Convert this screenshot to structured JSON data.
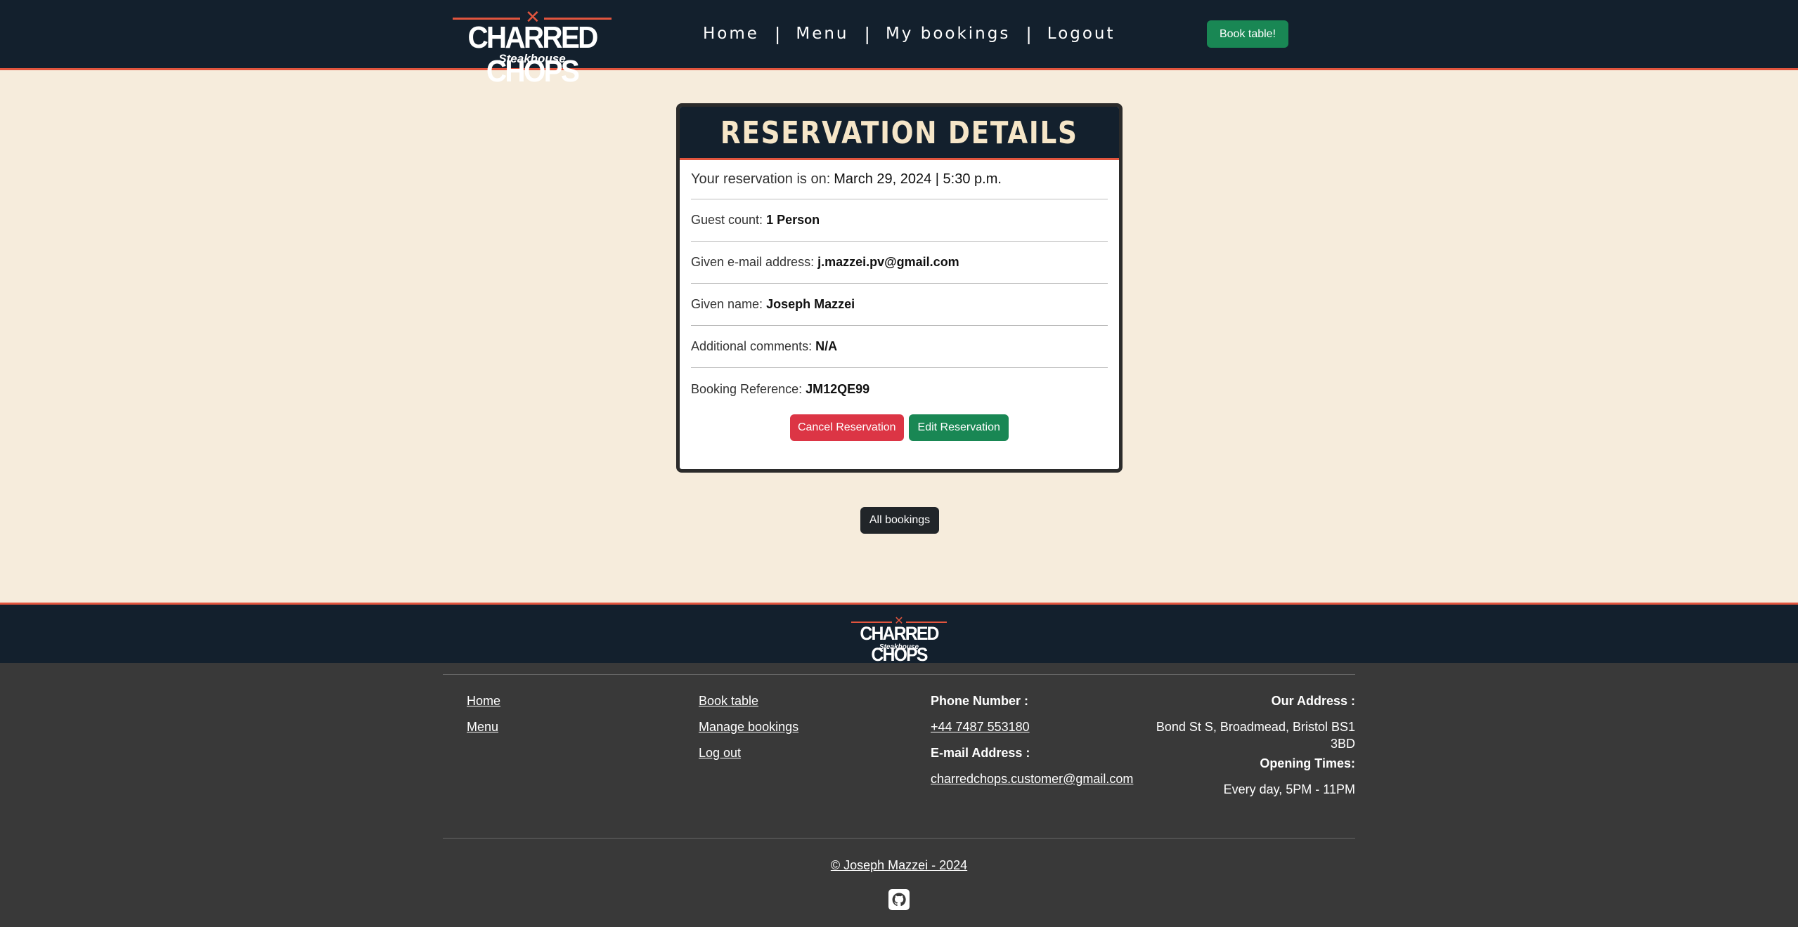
{
  "brand": {
    "name": "CHARRED CHOPS",
    "tagline": "Steakhouse"
  },
  "nav": {
    "links": [
      "Home",
      "Menu",
      "My bookings",
      "Logout"
    ],
    "separator": "|",
    "book_button": "Book table!"
  },
  "reservation": {
    "title": "RESERVATION DETAILS",
    "rows": [
      {
        "label": "Your reservation is on:",
        "value": "March 29, 2024 | 5:30 p.m."
      },
      {
        "label": "Guest count:",
        "value": "1 Person"
      },
      {
        "label": "Given e-mail address:",
        "value": "j.mazzei.pv@gmail.com"
      },
      {
        "label": "Given name:",
        "value": "Joseph Mazzei"
      },
      {
        "label": "Additional comments:",
        "value": "N/A"
      },
      {
        "label": "Booking Reference:",
        "value": "JM12QE99"
      }
    ],
    "cancel_button": "Cancel Reservation",
    "edit_button": "Edit Reservation"
  },
  "all_bookings_button": "All bookings",
  "footer": {
    "col1": [
      "Home",
      "Menu"
    ],
    "col2": [
      "Book table",
      "Manage bookings",
      "Log out"
    ],
    "phone_label": "Phone Number :",
    "phone": "+44 7487 553180",
    "email_label": "E-mail Address :",
    "email": "charredchops.customer@gmail.com",
    "address_label": "Our Address :",
    "address_line1": "Bond St S, Broadmead, Bristol BS1",
    "address_line2": "3BD",
    "hours_label": "Opening Times:",
    "hours": "Every day, 5PM - 11PM",
    "copyright": "© Joseph Mazzei - 2024",
    "github_icon": "github-icon"
  },
  "colors": {
    "navy": "#13202d",
    "accent": "#e2553e",
    "cream": "#f6ecdc",
    "success": "#198754",
    "danger": "#dc3545",
    "dark": "#212529",
    "footer_gray": "#393939"
  }
}
